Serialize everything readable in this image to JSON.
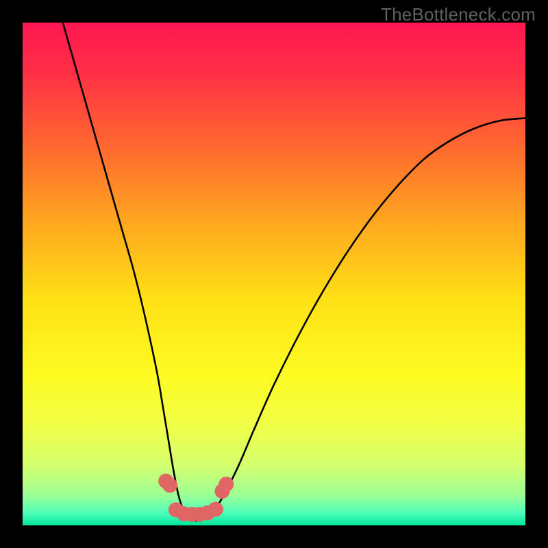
{
  "watermark": "TheBottleneck.com",
  "chart_data": {
    "type": "line",
    "title": "",
    "xlabel": "",
    "ylabel": "",
    "xlim": [
      0,
      100
    ],
    "ylim": [
      0,
      100
    ],
    "grid": false,
    "legend": false,
    "gradient_stops": [
      {
        "offset": 0.0,
        "color": "#ff1752"
      },
      {
        "offset": 0.1,
        "color": "#ff2f46"
      },
      {
        "offset": 0.25,
        "color": "#ff6a2f"
      },
      {
        "offset": 0.4,
        "color": "#ffa81f"
      },
      {
        "offset": 0.55,
        "color": "#ffe015"
      },
      {
        "offset": 0.7,
        "color": "#fdfb22"
      },
      {
        "offset": 0.8,
        "color": "#f1ff47"
      },
      {
        "offset": 0.88,
        "color": "#d4ff6e"
      },
      {
        "offset": 0.94,
        "color": "#9dff96"
      },
      {
        "offset": 0.975,
        "color": "#4fffba"
      },
      {
        "offset": 1.0,
        "color": "#00e69b"
      }
    ],
    "series": [
      {
        "name": "bottleneck-curve",
        "color": "#000000",
        "x": [
          8,
          10,
          12,
          14,
          16,
          18,
          20,
          22,
          24,
          26,
          27,
          28,
          29,
          30,
          31,
          32,
          33,
          34,
          35,
          36,
          38,
          40,
          43,
          46,
          50,
          55,
          60,
          65,
          70,
          75,
          80,
          85,
          90,
          95,
          100
        ],
        "y": [
          100,
          93,
          86,
          79,
          72,
          65,
          58,
          51,
          43,
          34,
          29,
          23,
          17,
          11,
          6,
          3,
          1.5,
          1,
          1,
          1.5,
          3,
          6,
          12,
          19,
          28,
          38,
          47,
          55,
          62,
          68,
          73,
          76.5,
          79,
          80.5,
          81
        ]
      }
    ],
    "markers": {
      "name": "highlight-dots",
      "color": "#e06666",
      "radius_px": 11,
      "points": [
        {
          "x": 28.5,
          "y": 8.8
        },
        {
          "x": 29.3,
          "y": 8.0
        },
        {
          "x": 30.5,
          "y": 3.1
        },
        {
          "x": 32.1,
          "y": 2.3
        },
        {
          "x": 33.7,
          "y": 2.2
        },
        {
          "x": 35.2,
          "y": 2.2
        },
        {
          "x": 36.8,
          "y": 2.5
        },
        {
          "x": 38.4,
          "y": 3.2
        },
        {
          "x": 39.7,
          "y": 6.8
        },
        {
          "x": 40.5,
          "y": 8.2
        }
      ]
    }
  }
}
